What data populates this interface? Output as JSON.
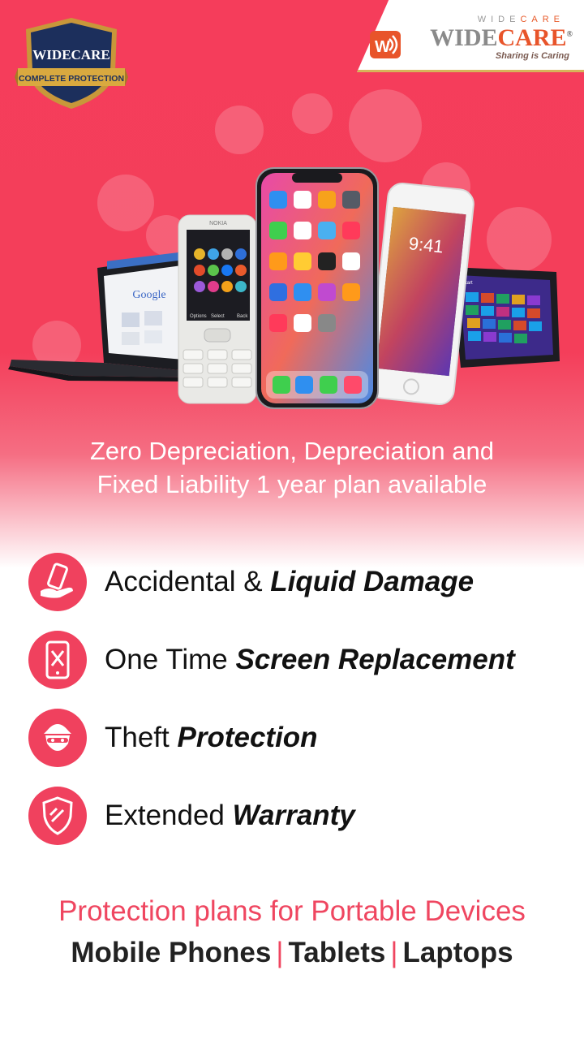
{
  "badge": {
    "title": "WIDECARE",
    "subtitle": "COMPLETE PROTECTION"
  },
  "brand": {
    "top": "WIDECARE",
    "name_a": "WIDE",
    "name_b": "CARE",
    "tagline": "Sharing is Caring",
    "reg": "®"
  },
  "hero": {
    "line1": "Zero Depreciation, Depreciation and",
    "line2": "Fixed Liability 1 year plan available"
  },
  "devices": {
    "phone_time": "9:41",
    "nokia_label": "NOKIA",
    "search_engine": "Google",
    "nokia_left": "Options",
    "nokia_mid": "Select",
    "nokia_right": "Back",
    "tablet_label": "Start"
  },
  "features": [
    {
      "plain": "Accidental & ",
      "bold": "Liquid Damage",
      "icon": "hand-phone-icon"
    },
    {
      "plain": "One Time ",
      "bold": "Screen Replacement",
      "icon": "phone-repair-icon"
    },
    {
      "plain": "Theft ",
      "bold": "Protection",
      "icon": "thief-icon"
    },
    {
      "plain": "Extended ",
      "bold": "Warranty",
      "icon": "shield-check-icon"
    }
  ],
  "footer": {
    "line1": "Protection plans for Portable Devices",
    "item1": "Mobile Phones",
    "item2": "Tablets",
    "item3": "Laptops",
    "sep": "|"
  },
  "colors": {
    "accent": "#f0415e",
    "hero": "#f43e5a",
    "gold": "#d7b45a"
  }
}
